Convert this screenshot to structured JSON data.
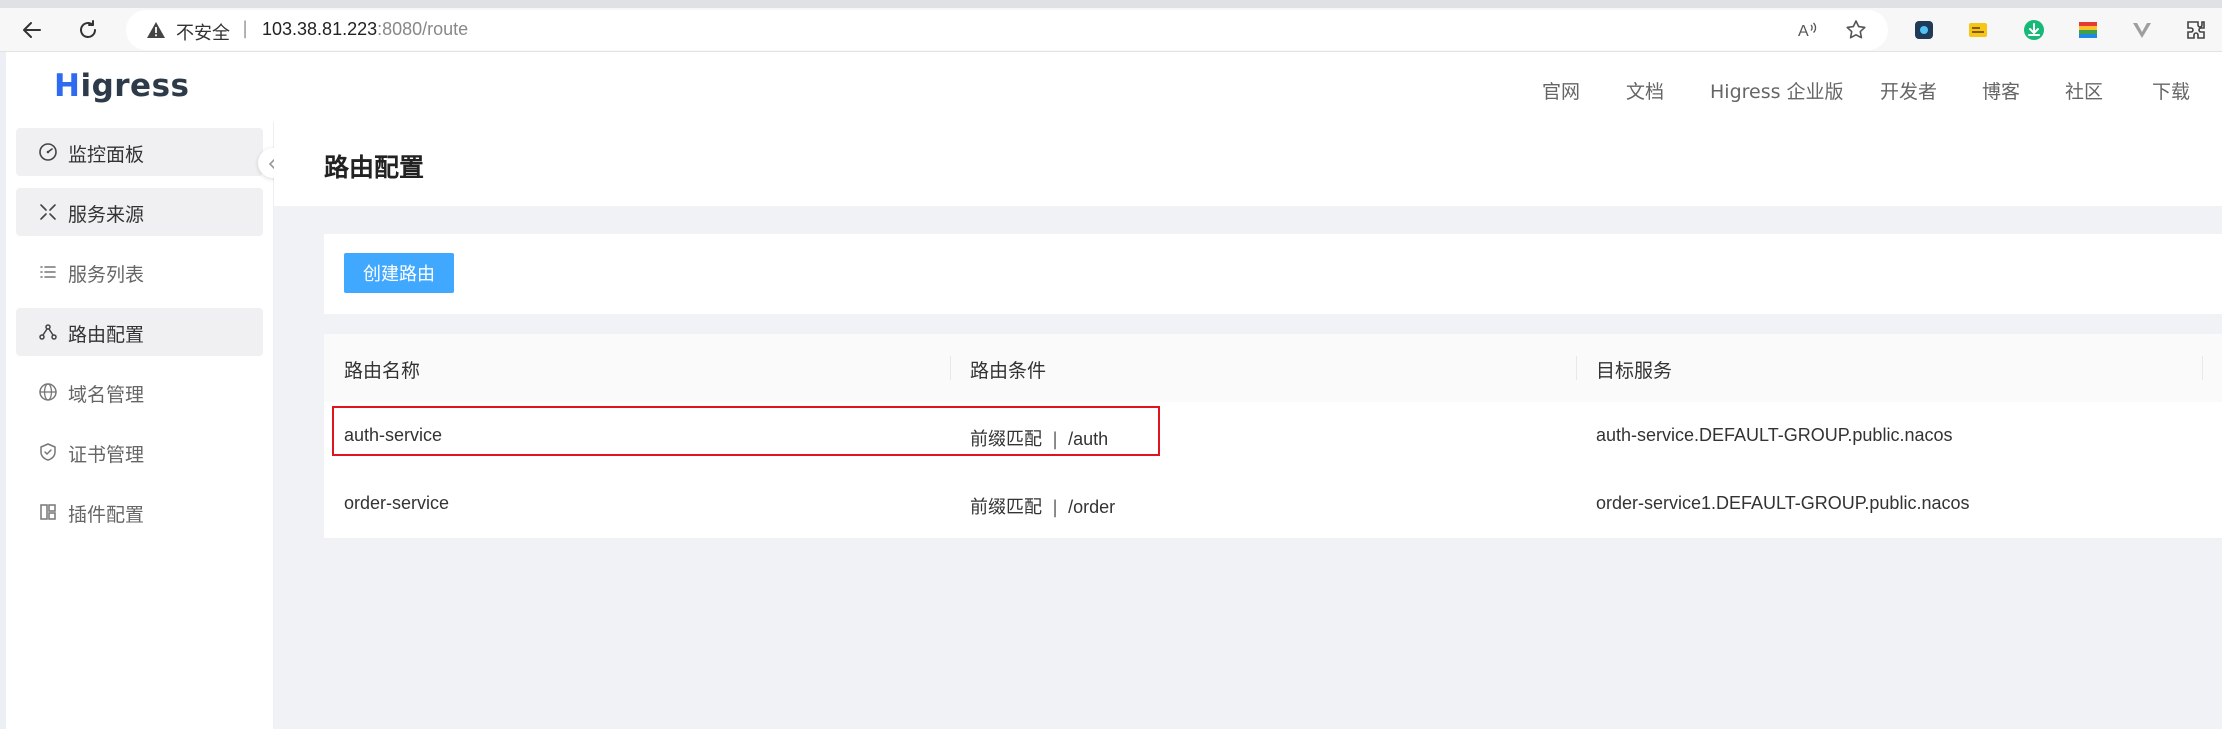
{
  "browser": {
    "security_label": "不安全",
    "url_host": "103.38.81.223",
    "url_rest": ":8080/route"
  },
  "app": {
    "logo_text_H": "H",
    "logo_text_rest": "igress",
    "top_nav": [
      "官网",
      "文档",
      "Higress 企业版",
      "开发者",
      "博客",
      "社区",
      "下载"
    ]
  },
  "sidebar": {
    "items": [
      {
        "label": "监控面板",
        "icon": "dashboard-icon"
      },
      {
        "label": "服务来源",
        "icon": "service-source-icon"
      },
      {
        "label": "服务列表",
        "icon": "list-icon"
      },
      {
        "label": "路由配置",
        "icon": "route-icon"
      },
      {
        "label": "域名管理",
        "icon": "globe-icon"
      },
      {
        "label": "证书管理",
        "icon": "shield-icon"
      },
      {
        "label": "插件配置",
        "icon": "plugin-icon"
      }
    ]
  },
  "page": {
    "title": "路由配置",
    "create_button": "创建路由"
  },
  "table": {
    "columns": [
      "路由名称",
      "路由条件",
      "目标服务"
    ],
    "rows": [
      {
        "name": "auth-service",
        "match_type": "前缀匹配",
        "separator": "|",
        "path": "/auth",
        "target": "auth-service.DEFAULT-GROUP.public.nacos"
      },
      {
        "name": "order-service",
        "match_type": "前缀匹配",
        "separator": "|",
        "path": "/order",
        "target": "order-service1.DEFAULT-GROUP.public.nacos"
      }
    ]
  },
  "colors": {
    "primary_button": "#40a9ff",
    "highlight_border": "#e0141e",
    "logo_accent": "#2f6bf1"
  }
}
